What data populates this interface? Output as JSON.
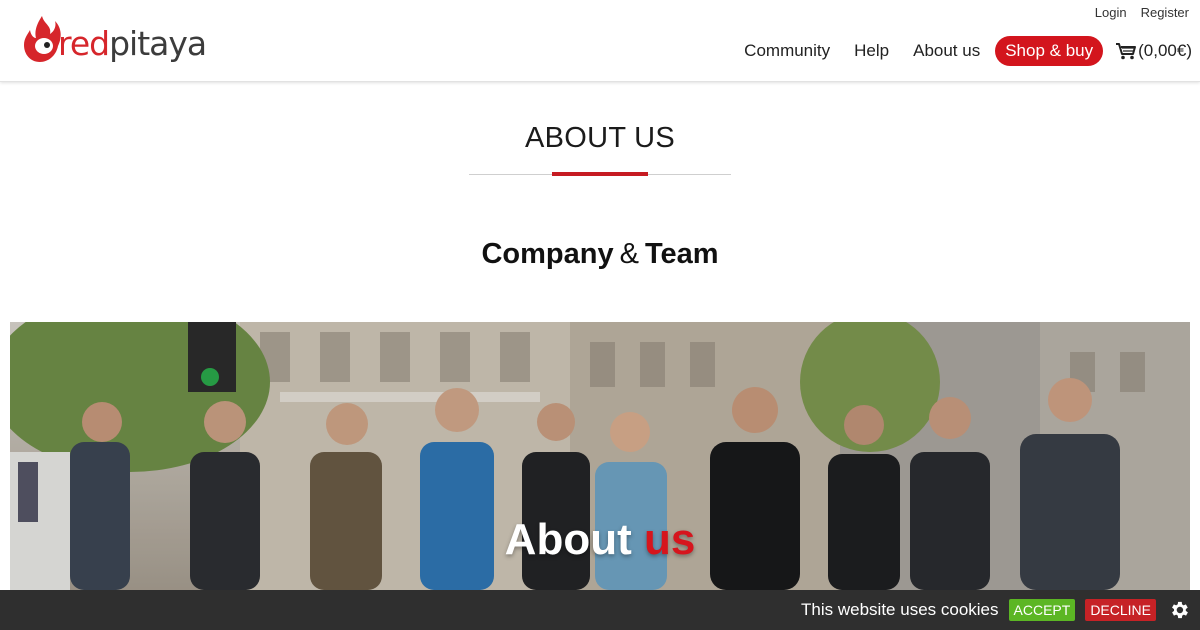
{
  "brand": {
    "name_part_red": "red",
    "name_part_dark": "pitaya",
    "accent_color": "#d6262b",
    "logo_icon": "pitaya-flame-logo"
  },
  "header": {
    "top_links": {
      "login": "Login",
      "register": "Register"
    },
    "nav": {
      "community": "Community",
      "help": "Help",
      "about": "About us",
      "shop": "Shop & buy"
    },
    "cart": {
      "icon": "cart-icon",
      "amount": "(0,00€)"
    }
  },
  "page": {
    "title": "ABOUT US",
    "section_title_left": "Company",
    "section_title_amp": "&",
    "section_title_right": "Team"
  },
  "hero": {
    "text_main": "About",
    "text_accent": "us",
    "accent_color": "#d6151d"
  },
  "cookie_bar": {
    "message": "This website uses cookies",
    "accept": "ACCEPT",
    "decline": "DECLINE",
    "settings_icon": "gear-icon"
  }
}
